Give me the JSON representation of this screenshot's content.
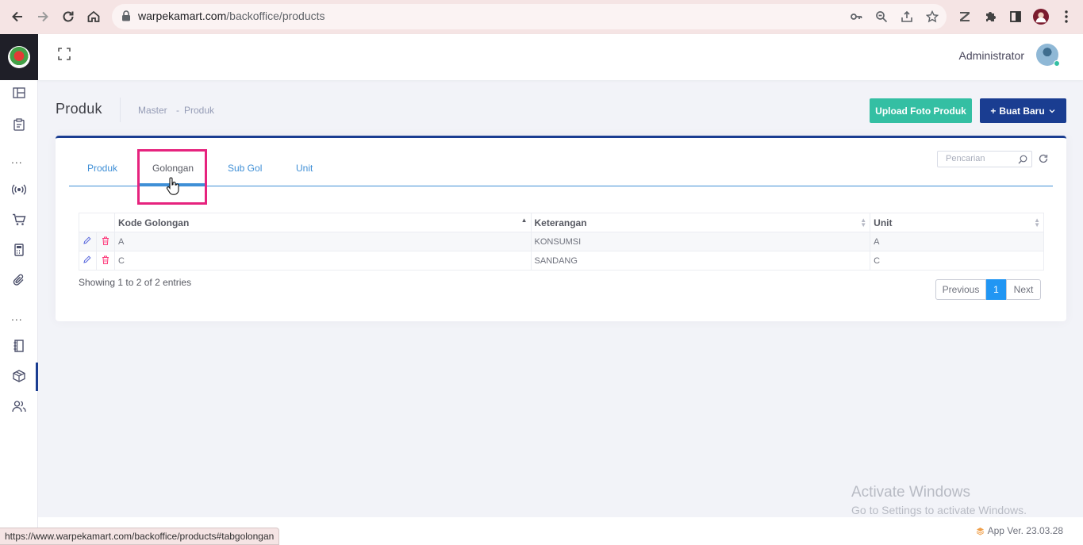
{
  "browser": {
    "url_domain": "warpekamart.com",
    "url_path": "/backoffice/products",
    "status_url": "https://www.warpekamart.com/backoffice/products#tabgolongan"
  },
  "header": {
    "user_name": "Administrator"
  },
  "page": {
    "title": "Produk",
    "breadcrumb": [
      "Master",
      "-",
      "Produk"
    ],
    "upload_button": "Upload Foto Produk",
    "new_button": "Buat Baru",
    "new_button_icon": "+"
  },
  "tabs": [
    {
      "label": "Produk",
      "active": false
    },
    {
      "label": "Golongan",
      "active": true
    },
    {
      "label": "Sub Gol",
      "active": false
    },
    {
      "label": "Unit",
      "active": false
    }
  ],
  "search": {
    "placeholder": "Pencarian"
  },
  "table": {
    "columns": [
      "Kode Golongan",
      "Keterangan",
      "Unit"
    ],
    "rows": [
      {
        "kode": "A",
        "keterangan": "KONSUMSI",
        "unit": "A"
      },
      {
        "kode": "C",
        "keterangan": "SANDANG",
        "unit": "C"
      }
    ],
    "info": "Showing 1 to 2 of 2 entries"
  },
  "pagination": {
    "previous": "Previous",
    "current": "1",
    "next": "Next"
  },
  "watermark": {
    "line1": "Activate Windows",
    "line2": "Go to Settings to activate Windows."
  },
  "footer": {
    "version": "App Ver. 23.03.28"
  },
  "colors": {
    "primary": "#1a3d91",
    "success": "#34bfa3",
    "tab_accent": "#3f8fd6",
    "highlight": "#e6237e"
  },
  "icons": {
    "sidebar": [
      "dashboard-icon",
      "clipboard-icon",
      "more-icon",
      "broadcast-icon",
      "cart-icon",
      "calculator-icon",
      "paperclip-icon",
      "more-icon",
      "book-icon",
      "box-icon",
      "users-icon"
    ]
  }
}
